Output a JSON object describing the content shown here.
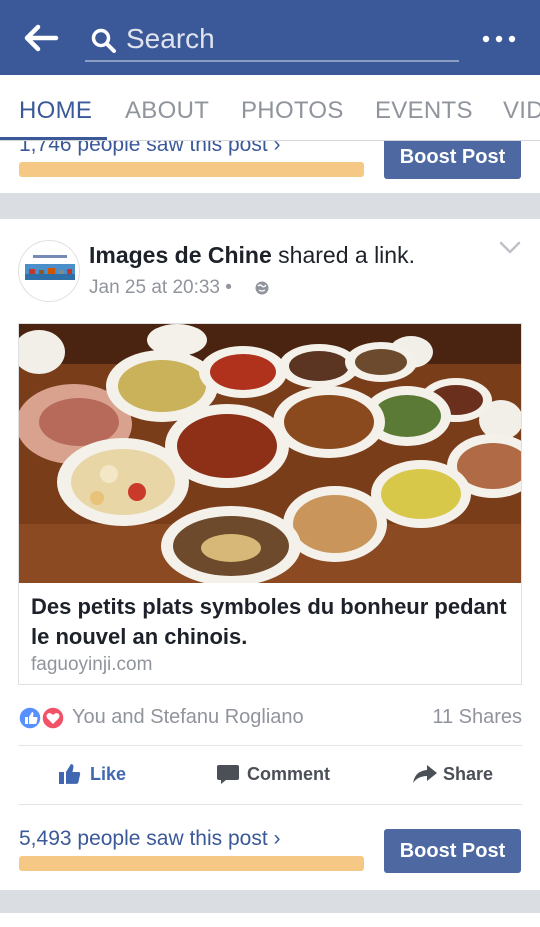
{
  "topbar": {
    "search_placeholder": "Search"
  },
  "tabs": [
    {
      "label": "HOME"
    },
    {
      "label": "ABOUT"
    },
    {
      "label": "PHOTOS"
    },
    {
      "label": "EVENTS"
    },
    {
      "label": "VID"
    }
  ],
  "prev_post": {
    "seen_text": "1,746 people saw this post ›",
    "boost_label": "Boost Post"
  },
  "post": {
    "author": "Images de Chine",
    "action_text": " shared a link.",
    "meta": "Jan 25 at 20:33 •",
    "link_title": "Des petits plats symboles du bonheur pedant le nouvel an chinois.",
    "link_domain": "faguoyinji.com",
    "reactions_text": "You and Stefanu Rogliano",
    "shares_text": "11 Shares",
    "actions": {
      "like": "Like",
      "comment": "Comment",
      "share": "Share"
    },
    "seen_text": "5,493 people saw this post ›",
    "boost_label": "Boost Post"
  },
  "colors": {
    "brand": "#3b5998",
    "boost": "#4e69a2",
    "progress": "#f5c985"
  }
}
